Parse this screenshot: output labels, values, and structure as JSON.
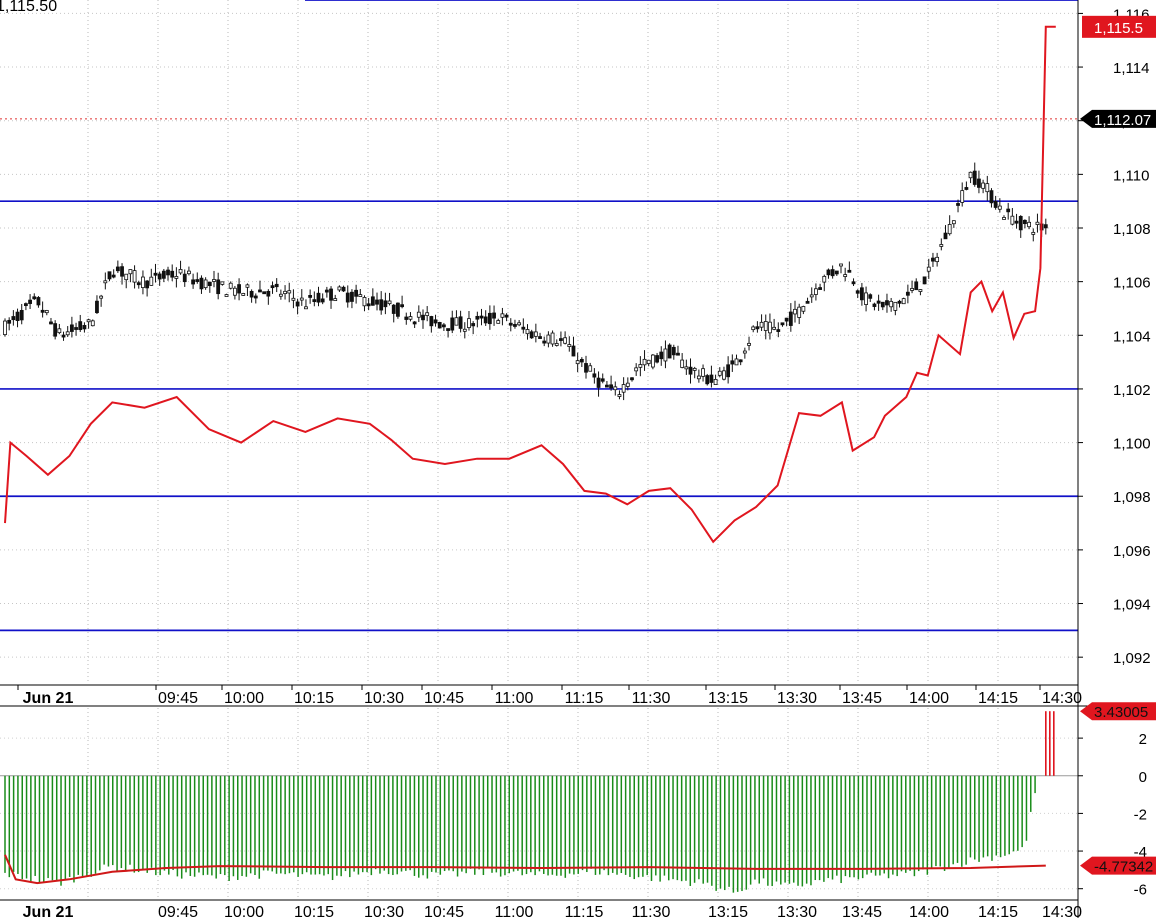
{
  "chart_data": [
    {
      "type": "candlestick",
      "title": "1,115.50",
      "x_ticks": [
        "Jun 21",
        "09:45",
        "10:00",
        "10:15",
        "10:30",
        "10:45",
        "11:00",
        "11:15",
        "11:30",
        "13:15",
        "13:30",
        "13:45",
        "14:00",
        "14:15",
        "14:30"
      ],
      "y_ticks": [
        "1,116",
        "1,114",
        "1,112",
        "1,110",
        "1,108",
        "1,106",
        "1,104",
        "1,102",
        "1,100",
        "1,098",
        "1,096",
        "1,094",
        "1,092"
      ],
      "ylim": [
        1091,
        1116.5
      ],
      "grid": true,
      "horizontal_levels": [
        1116.5,
        1109.0,
        1102.0,
        1098.0,
        1093.0
      ],
      "level_color": "#1010c8",
      "last_price": {
        "label": "1,112.07",
        "value": 1112.07
      },
      "red_line_last": {
        "label": "1,115.5",
        "value": 1115.5
      },
      "candle_path": [
        [
          0,
          1104.3
        ],
        [
          0.03,
          1105.3
        ],
        [
          0.05,
          1104.0
        ],
        [
          0.08,
          1104.4
        ],
        [
          0.1,
          1106.5
        ],
        [
          0.13,
          1106.0
        ],
        [
          0.16,
          1106.3
        ],
        [
          0.19,
          1105.9
        ],
        [
          0.22,
          1105.6
        ],
        [
          0.25,
          1105.7
        ],
        [
          0.28,
          1105.2
        ],
        [
          0.31,
          1105.6
        ],
        [
          0.34,
          1105.3
        ],
        [
          0.37,
          1104.9
        ],
        [
          0.4,
          1104.5
        ],
        [
          0.43,
          1104.4
        ],
        [
          0.46,
          1104.7
        ],
        [
          0.49,
          1104.1
        ],
        [
          0.52,
          1103.8
        ],
        [
          0.55,
          1102.4
        ],
        [
          0.57,
          1101.8
        ],
        [
          0.59,
          1102.8
        ],
        [
          0.62,
          1103.4
        ],
        [
          0.64,
          1102.7
        ],
        [
          0.66,
          1102.3
        ],
        [
          0.68,
          1102.9
        ],
        [
          0.7,
          1104.3
        ],
        [
          0.72,
          1104.2
        ],
        [
          0.74,
          1104.9
        ],
        [
          0.76,
          1106.0
        ],
        [
          0.78,
          1106.6
        ],
        [
          0.79,
          1106.2
        ],
        [
          0.8,
          1105.4
        ],
        [
          0.82,
          1105.0
        ],
        [
          0.84,
          1105.4
        ],
        [
          0.86,
          1106.2
        ],
        [
          0.88,
          1108.0
        ],
        [
          0.89,
          1109.0
        ],
        [
          0.9,
          1110.0
        ],
        [
          0.91,
          1109.7
        ],
        [
          0.93,
          1108.6
        ],
        [
          0.95,
          1108.1
        ],
        [
          0.97,
          1108.0
        ]
      ],
      "red_line": [
        [
          0,
          1097.0
        ],
        [
          0.005,
          1100.0
        ],
        [
          0.02,
          1099.5
        ],
        [
          0.04,
          1098.8
        ],
        [
          0.06,
          1099.5
        ],
        [
          0.08,
          1100.7
        ],
        [
          0.1,
          1101.5
        ],
        [
          0.13,
          1101.3
        ],
        [
          0.16,
          1101.7
        ],
        [
          0.19,
          1100.5
        ],
        [
          0.22,
          1100.0
        ],
        [
          0.25,
          1100.8
        ],
        [
          0.28,
          1100.4
        ],
        [
          0.31,
          1100.9
        ],
        [
          0.34,
          1100.7
        ],
        [
          0.36,
          1100.1
        ],
        [
          0.38,
          1099.4
        ],
        [
          0.41,
          1099.2
        ],
        [
          0.44,
          1099.4
        ],
        [
          0.47,
          1099.4
        ],
        [
          0.5,
          1099.9
        ],
        [
          0.52,
          1099.2
        ],
        [
          0.54,
          1098.2
        ],
        [
          0.56,
          1098.1
        ],
        [
          0.58,
          1097.7
        ],
        [
          0.6,
          1098.2
        ],
        [
          0.62,
          1098.3
        ],
        [
          0.64,
          1097.5
        ],
        [
          0.66,
          1096.3
        ],
        [
          0.68,
          1097.1
        ],
        [
          0.7,
          1097.6
        ],
        [
          0.72,
          1098.4
        ],
        [
          0.74,
          1101.1
        ],
        [
          0.76,
          1101.0
        ],
        [
          0.78,
          1101.5
        ],
        [
          0.79,
          1099.7
        ],
        [
          0.81,
          1100.2
        ],
        [
          0.82,
          1101.0
        ],
        [
          0.84,
          1101.7
        ],
        [
          0.85,
          1102.6
        ],
        [
          0.86,
          1102.5
        ],
        [
          0.87,
          1104.0
        ],
        [
          0.89,
          1103.3
        ],
        [
          0.9,
          1105.6
        ],
        [
          0.91,
          1106.0
        ],
        [
          0.92,
          1104.9
        ],
        [
          0.93,
          1105.6
        ],
        [
          0.94,
          1103.9
        ],
        [
          0.95,
          1104.8
        ],
        [
          0.96,
          1104.9
        ],
        [
          0.965,
          1106.5
        ],
        [
          0.97,
          1115.5
        ]
      ]
    },
    {
      "type": "bar",
      "x_ticks": [
        "Jun 21",
        "09:45",
        "10:00",
        "10:15",
        "10:30",
        "10:45",
        "11:00",
        "11:15",
        "11:30",
        "13:15",
        "13:30",
        "13:45",
        "14:00",
        "14:15",
        "14:30"
      ],
      "y_ticks": [
        "2",
        "0",
        "-2",
        "-4",
        "-6"
      ],
      "ylim": [
        -6.6,
        3.6
      ],
      "value_label": "3.43005",
      "signal_label": "-4.77342",
      "bar_color": "#1a8c1a",
      "signal_color": "#d01818",
      "final_positive_values": [
        3.43005,
        3.43005,
        3.43005
      ],
      "histogram_envelope": [
        [
          0,
          -5.2
        ],
        [
          0.05,
          -5.7
        ],
        [
          0.1,
          -4.8
        ],
        [
          0.15,
          -5.2
        ],
        [
          0.2,
          -5.4
        ],
        [
          0.25,
          -5.2
        ],
        [
          0.3,
          -5.4
        ],
        [
          0.35,
          -5.0
        ],
        [
          0.4,
          -5.3
        ],
        [
          0.45,
          -5.1
        ],
        [
          0.5,
          -5.3
        ],
        [
          0.55,
          -5.1
        ],
        [
          0.6,
          -5.4
        ],
        [
          0.65,
          -5.7
        ],
        [
          0.68,
          -6.2
        ],
        [
          0.7,
          -5.6
        ],
        [
          0.73,
          -5.9
        ],
        [
          0.76,
          -5.6
        ],
        [
          0.8,
          -5.4
        ],
        [
          0.85,
          -5.2
        ],
        [
          0.9,
          -4.5
        ],
        [
          0.93,
          -4.2
        ],
        [
          0.95,
          -3.9
        ],
        [
          0.96,
          -0.9
        ],
        [
          0.97,
          3.43
        ]
      ],
      "signal_line": [
        [
          0,
          -4.2
        ],
        [
          0.01,
          -5.5
        ],
        [
          0.03,
          -5.7
        ],
        [
          0.06,
          -5.5
        ],
        [
          0.1,
          -5.1
        ],
        [
          0.15,
          -4.9
        ],
        [
          0.2,
          -4.8
        ],
        [
          0.3,
          -4.85
        ],
        [
          0.4,
          -4.85
        ],
        [
          0.5,
          -4.9
        ],
        [
          0.6,
          -4.85
        ],
        [
          0.7,
          -4.95
        ],
        [
          0.8,
          -4.95
        ],
        [
          0.9,
          -4.9
        ],
        [
          0.97,
          -4.77
        ]
      ]
    }
  ]
}
